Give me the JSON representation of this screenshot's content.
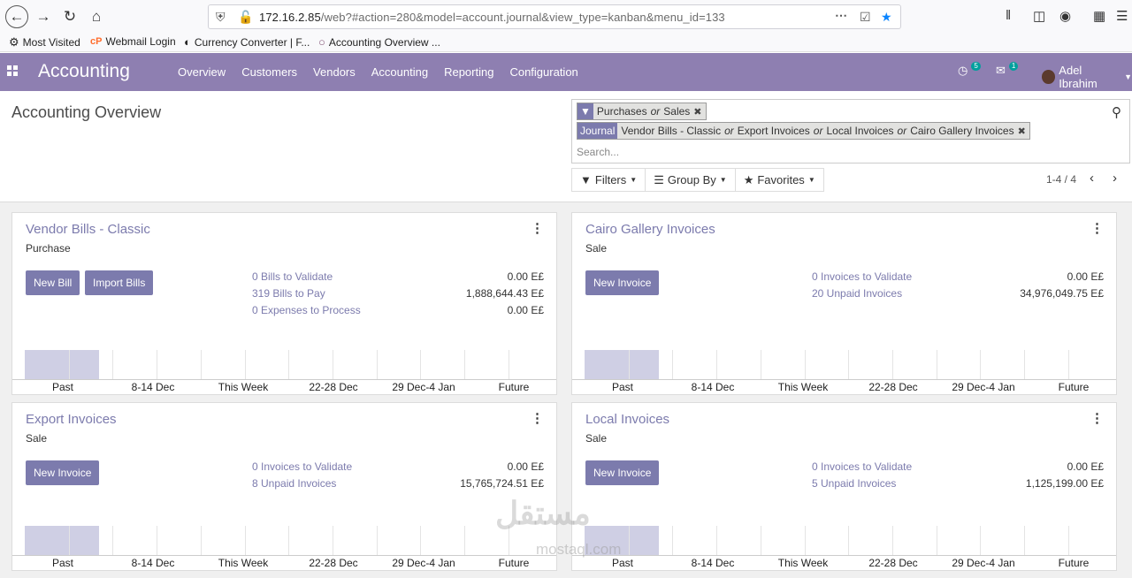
{
  "browser": {
    "url_host": "172.16.2.85",
    "url_path": "/web?#action=280&model=account.journal&view_type=kanban&menu_id=133",
    "bookmarks": [
      "Most Visited",
      "Webmail Login",
      "Currency Converter | F...",
      "Accounting Overview ..."
    ]
  },
  "app": {
    "brand": "Accounting",
    "menu": [
      "Overview",
      "Customers",
      "Vendors",
      "Accounting",
      "Reporting",
      "Configuration"
    ],
    "activity_count": "5",
    "message_count": "1",
    "user": "Adel Ibrahim"
  },
  "control": {
    "breadcrumb": "Accounting Overview",
    "facet1": {
      "value_a": "Purchases",
      "sep": "or",
      "value_b": "Sales"
    },
    "facet2": {
      "label": "Journal",
      "v1": "Vendor Bills - Classic",
      "or1": "or",
      "v2": "Export Invoices",
      "or2": "or",
      "v3": "Local Invoices",
      "or3": "or",
      "v4": "Cairo Gallery Invoices"
    },
    "search_placeholder": "Search...",
    "filters": "Filters",
    "group_by": "Group By",
    "favorites": "Favorites",
    "pager": "1-4 / 4"
  },
  "graph_labels": [
    "Past",
    "8-14 Dec",
    "This Week",
    "22-28 Dec",
    "29 Dec-4 Jan",
    "Future"
  ],
  "cards": [
    {
      "title": "Vendor Bills - Classic",
      "type": "Purchase",
      "buttons": [
        "New Bill",
        "Import Bills"
      ],
      "lines": [
        {
          "label": "0 Bills to Validate",
          "amount": "0.00 E£"
        },
        {
          "label": "319 Bills to Pay",
          "amount": "1,888,644.43 E£"
        },
        {
          "label": "0 Expenses to Process",
          "amount": "0.00 E£"
        }
      ]
    },
    {
      "title": "Cairo Gallery Invoices",
      "type": "Sale",
      "buttons": [
        "New Invoice"
      ],
      "lines": [
        {
          "label": "0 Invoices to Validate",
          "amount": "0.00 E£"
        },
        {
          "label": "20 Unpaid Invoices",
          "amount": "34,976,049.75 E£"
        }
      ]
    },
    {
      "title": "Export Invoices",
      "type": "Sale",
      "buttons": [
        "New Invoice"
      ],
      "lines": [
        {
          "label": "0 Invoices to Validate",
          "amount": "0.00 E£"
        },
        {
          "label": "8 Unpaid Invoices",
          "amount": "15,765,724.51 E£"
        }
      ]
    },
    {
      "title": "Local Invoices",
      "type": "Sale",
      "buttons": [
        "New Invoice"
      ],
      "lines": [
        {
          "label": "0 Invoices to Validate",
          "amount": "0.00 E£"
        },
        {
          "label": "5 Unpaid Invoices",
          "amount": "1,125,199.00 E£"
        }
      ]
    }
  ],
  "watermark": {
    "arabic": "مستقل",
    "latin": "mostaql.com"
  }
}
